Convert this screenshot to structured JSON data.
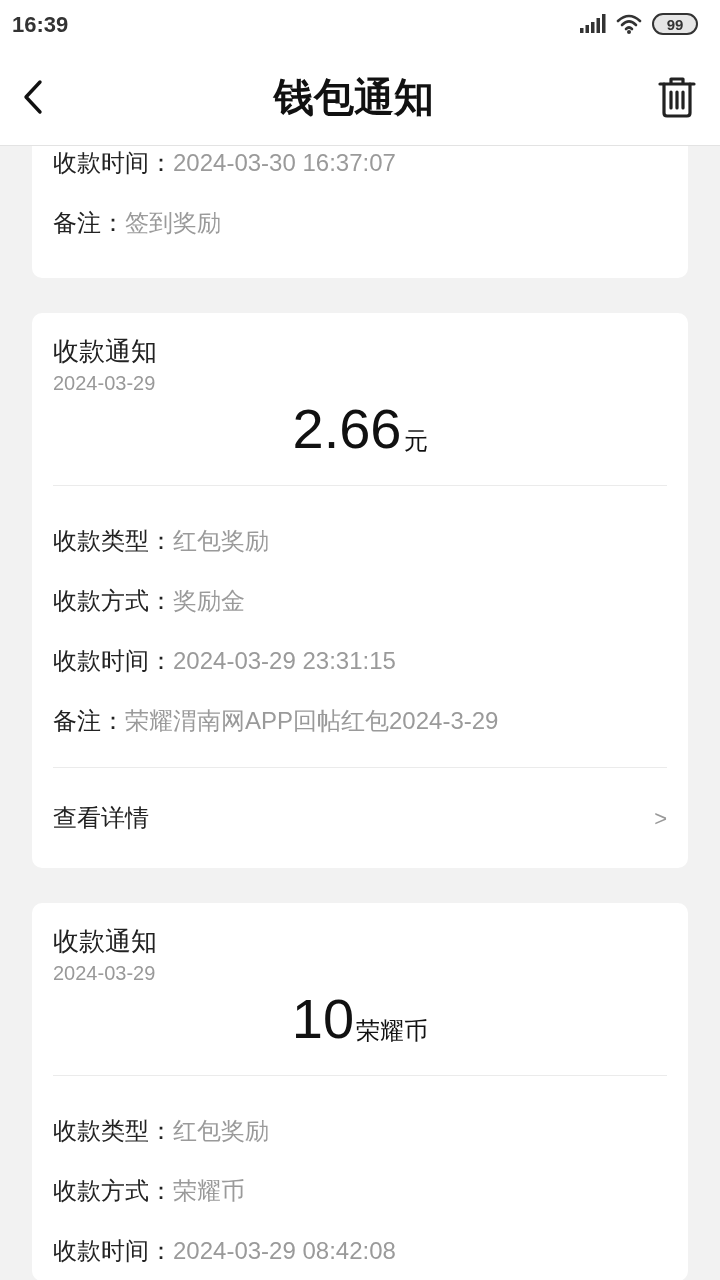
{
  "status_bar": {
    "time": "16:39",
    "battery": "99"
  },
  "header": {
    "title": "钱包通知"
  },
  "cards": [
    {
      "fields": [
        {
          "label": "收款时间：",
          "value": "2024-03-30 16:37:07"
        },
        {
          "label": "备注：",
          "value": "签到奖励"
        }
      ]
    },
    {
      "title": "收款通知",
      "date": "2024-03-29",
      "amount": "2.66",
      "unit": "元",
      "fields": [
        {
          "label": "收款类型：",
          "value": "红包奖励"
        },
        {
          "label": "收款方式：",
          "value": "奖励金"
        },
        {
          "label": "收款时间：",
          "value": "2024-03-29 23:31:15"
        },
        {
          "label": "备注：",
          "value": "荣耀渭南网APP回帖红包2024-3-29"
        }
      ],
      "details_link": {
        "label": "查看详情",
        "chevron": ">"
      }
    },
    {
      "title": "收款通知",
      "date": "2024-03-29",
      "amount": "10",
      "unit": "荣耀币",
      "fields": [
        {
          "label": "收款类型：",
          "value": "红包奖励"
        },
        {
          "label": "收款方式：",
          "value": "荣耀币"
        },
        {
          "label": "收款时间：",
          "value": "2024-03-29 08:42:08"
        }
      ]
    }
  ]
}
